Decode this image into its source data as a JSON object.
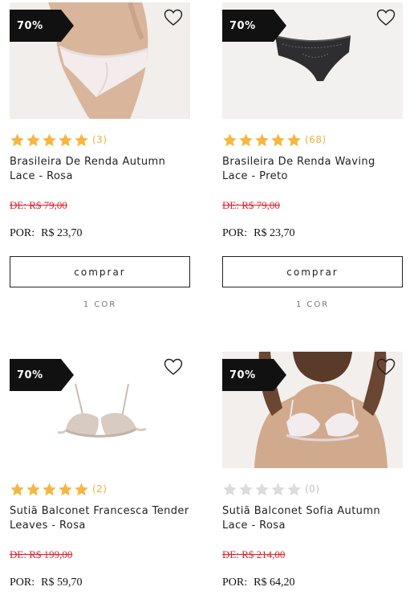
{
  "colors": {
    "star_filled": "#f5b642",
    "star_empty": "#dcdcdc",
    "old_price": "#e0202a",
    "badge": "#111111"
  },
  "products": [
    {
      "discount": "70%",
      "image": "lace-brief-rosa",
      "rating": 5,
      "reviews": "(3)",
      "name": "Brasileira De Renda Autumn Lace - Rosa",
      "old_price": "DE: R$ 79,00",
      "por_label": "POR:",
      "price": "R$ 23,70",
      "buy_label": "comprar",
      "colors_label": "1 COR"
    },
    {
      "discount": "70%",
      "image": "lace-brief-preto",
      "rating": 5,
      "reviews": "(68)",
      "name": "Brasileira De Renda Waving Lace - Preto",
      "old_price": "DE: R$ 79,00",
      "por_label": "POR:",
      "price": "R$ 23,70",
      "buy_label": "comprar",
      "colors_label": "1 COR"
    },
    {
      "discount": "70%",
      "image": "balconet-bra-nude",
      "rating": 5,
      "reviews": "(2)",
      "name": "Sutiã Balconet Francesca Tender Leaves - Rosa",
      "old_price": "DE: R$ 199,00",
      "por_label": "POR:",
      "price": "R$ 59,70"
    },
    {
      "discount": "70%",
      "image": "balconet-bra-model",
      "rating": 0,
      "reviews": "(0)",
      "name": "Sutiã Balconet Sofia Autumn Lace - Rosa",
      "old_price": "DE: R$ 214,00",
      "por_label": "POR:",
      "price": "R$ 64,20"
    }
  ]
}
